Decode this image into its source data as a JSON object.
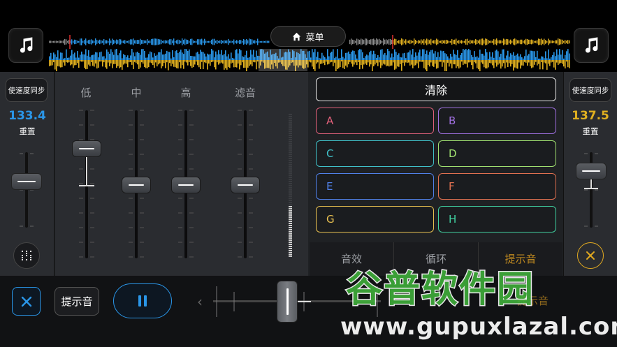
{
  "menu": {
    "label": "菜单",
    "icon": "home-icon"
  },
  "deck_left": {
    "art_icon": "music-note-icon",
    "sync_label": "使速度同步",
    "bpm": "133.4",
    "reset_label": "重置",
    "color": "#2a96e8",
    "grid_icon": "grid-dots-icon"
  },
  "deck_right": {
    "art_icon": "music-note-icon",
    "sync_label": "使速度同步",
    "bpm": "137.5",
    "reset_label": "重置",
    "color": "#e0b020",
    "close_icon": "close-icon"
  },
  "mixer": {
    "eq_labels": [
      "低",
      "中",
      "高",
      "滤音"
    ]
  },
  "pads": {
    "clear_label": "清除",
    "items": [
      {
        "label": "A",
        "color": "#e0607a"
      },
      {
        "label": "B",
        "color": "#a070e0"
      },
      {
        "label": "C",
        "color": "#40c0c8"
      },
      {
        "label": "D",
        "color": "#a0e070"
      },
      {
        "label": "E",
        "color": "#5080e8"
      },
      {
        "label": "F",
        "color": "#e07050"
      },
      {
        "label": "G",
        "color": "#e8c050"
      },
      {
        "label": "H",
        "color": "#40d0a0"
      }
    ]
  },
  "tabs": [
    "音效",
    "循环",
    "提示音"
  ],
  "bottom": {
    "cue_label": "提示音",
    "right_cue_label": "提示音",
    "close_icon": "close-icon",
    "play_icon": "pause-icon",
    "arrow_icon": "chevron-left-icon"
  },
  "watermark": {
    "title": "谷普软件园",
    "url": "www.gupuxlazal.com"
  }
}
